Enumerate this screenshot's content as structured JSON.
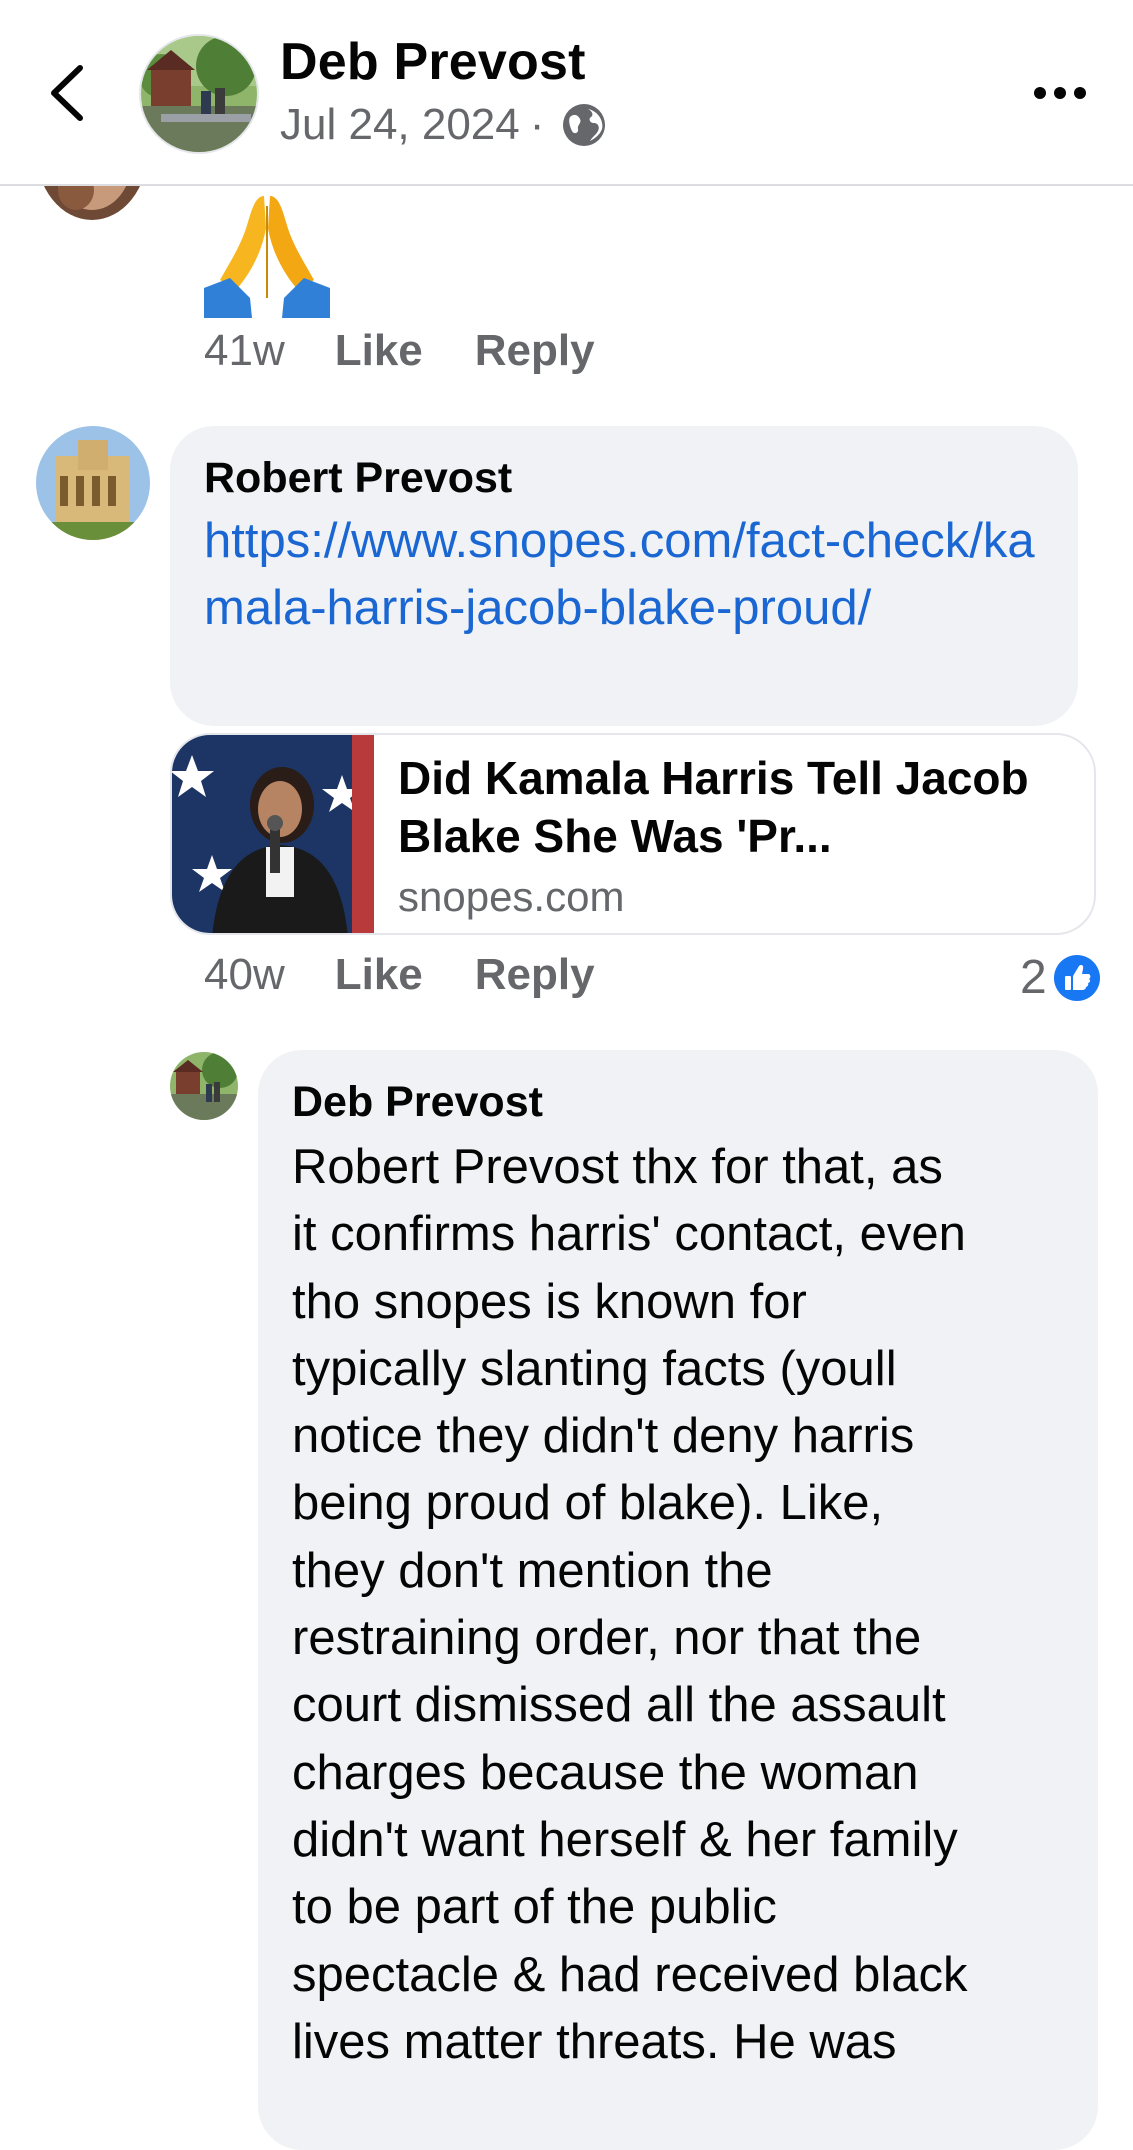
{
  "header": {
    "name": "Deb Prevost",
    "date": "Jul 24, 2024",
    "separator": "·",
    "icons": {
      "back": "chevron-left-icon",
      "privacy": "globe-icon",
      "menu": "more-horizontal-icon"
    }
  },
  "comment_prev": {
    "emoji": "🙏",
    "time": "41w",
    "like_label": "Like",
    "reply_label": "Reply"
  },
  "comment_robert": {
    "author": "Robert Prevost",
    "link_text": "https://www.snopes.com/fact-check/kamala-harris-jacob-blake-proud/",
    "preview": {
      "title": "Did Kamala Harris Tell Jacob Blake She Was 'Pr...",
      "domain": "snopes.com"
    },
    "time": "40w",
    "like_label": "Like",
    "reply_label": "Reply",
    "reaction_count": "2",
    "reaction_icon": "thumbs-up-icon"
  },
  "reply_deb": {
    "author": "Deb Prevost",
    "lines": [
      "Robert Prevost thx for that, as",
      "it confirms harris' contact, even",
      "tho snopes is known for",
      "typically slanting facts (youll",
      "notice they didn't deny harris",
      "being proud of blake). Like,",
      "they don't mention the",
      "restraining order, nor that the",
      "court dismissed all the assault",
      "charges because the woman",
      "didn't want herself & her family",
      "to be part of the public",
      "spectacle & had received black",
      "lives matter threats. He was"
    ]
  },
  "colors": {
    "link": "#1a66d2",
    "bubble": "#f0f2f5",
    "secondary_text": "#65676b",
    "like_blue": "#1877f2"
  }
}
